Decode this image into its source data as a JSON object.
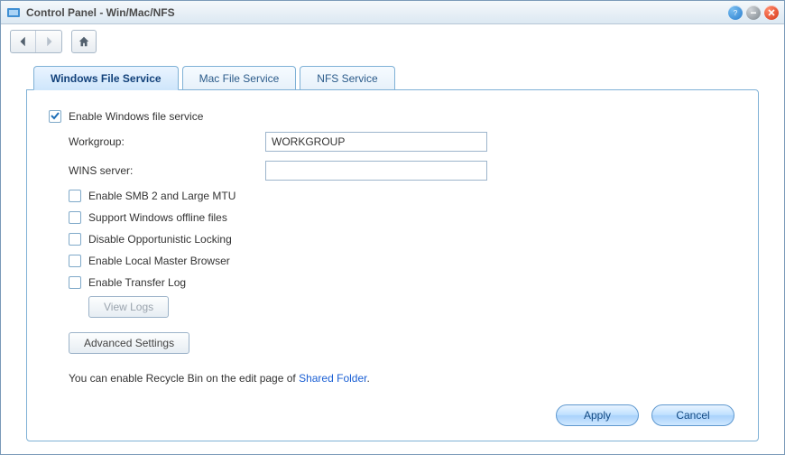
{
  "window": {
    "title": "Control Panel - Win/Mac/NFS"
  },
  "tabs": [
    {
      "label": "Windows File Service",
      "active": true
    },
    {
      "label": "Mac File Service",
      "active": false
    },
    {
      "label": "NFS Service",
      "active": false
    }
  ],
  "win_file_service": {
    "enable": {
      "label": "Enable Windows file service",
      "checked": true
    },
    "workgroup_label": "Workgroup:",
    "workgroup_value": "WORKGROUP",
    "wins_label": "WINS server:",
    "wins_value": "",
    "options": [
      {
        "key": "smb2",
        "label": "Enable SMB 2 and Large MTU",
        "checked": false
      },
      {
        "key": "offline",
        "label": "Support Windows offline files",
        "checked": false
      },
      {
        "key": "oplock",
        "label": "Disable Opportunistic Locking",
        "checked": false
      },
      {
        "key": "master",
        "label": "Enable Local Master Browser",
        "checked": false
      },
      {
        "key": "xferlog",
        "label": "Enable Transfer Log",
        "checked": false
      }
    ],
    "view_logs": "View Logs",
    "advanced": "Advanced Settings",
    "note_prefix": "You can enable Recycle Bin on the edit page of ",
    "note_link": "Shared Folder",
    "note_suffix": "."
  },
  "buttons": {
    "apply": "Apply",
    "cancel": "Cancel"
  }
}
